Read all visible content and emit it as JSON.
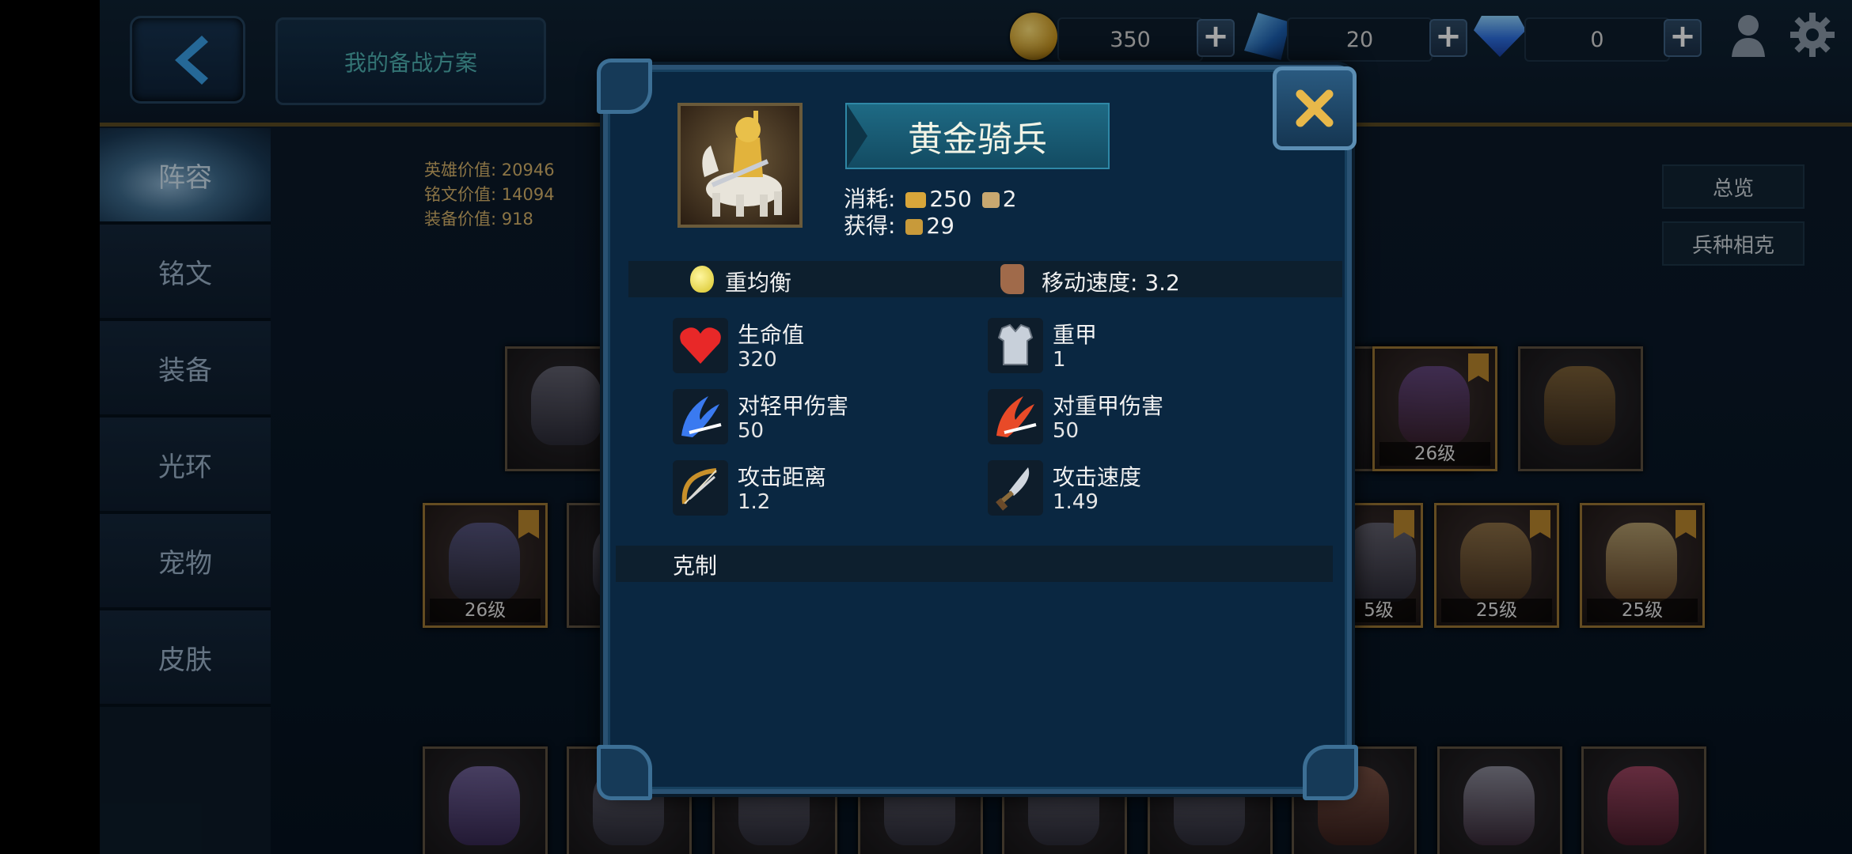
{
  "header": {
    "plan_button": "我的备战方案",
    "gold": "350",
    "crystal": "20",
    "diamond": "0"
  },
  "sidebar": {
    "tabs": [
      "阵容",
      "铭文",
      "装备",
      "光环",
      "宠物",
      "皮肤"
    ],
    "active_index": 0
  },
  "summary": {
    "hero_value": "英雄价值: 20946",
    "rune_value": "铭文价值: 14094",
    "equip_value": "装备价值: 918"
  },
  "right_buttons": {
    "overview": "总览",
    "counter": "兵种相克"
  },
  "cards": {
    "row2": [
      "26级"
    ],
    "row3_left": [
      "26级"
    ],
    "row3_right": [
      "5级",
      "25级",
      "25级"
    ]
  },
  "unit": {
    "name": "黄金骑兵",
    "cost_label": "消耗:",
    "cost_food": "250",
    "cost_pop": "2",
    "gain_label": "获得:",
    "gain_value": "29",
    "weight": "重均衡",
    "move_speed": "移动速度: 3.2",
    "stats": [
      {
        "name": "生命值",
        "value": "320",
        "icon": "heart-icon"
      },
      {
        "name": "重甲",
        "value": "1",
        "icon": "armor-icon"
      },
      {
        "name": "对轻甲伤害",
        "value": "50",
        "icon": "blue-slash-icon"
      },
      {
        "name": "对重甲伤害",
        "value": "50",
        "icon": "red-slash-icon"
      },
      {
        "name": "攻击距离",
        "value": "1.2",
        "icon": "bow-icon"
      },
      {
        "name": "攻击速度",
        "value": "1.49",
        "icon": "dagger-icon"
      }
    ],
    "counter_title": "克制"
  },
  "colors": {
    "accent_gold": "#d6b36a",
    "panel": "#0a2741",
    "teal_text": "#4fb3b3"
  }
}
